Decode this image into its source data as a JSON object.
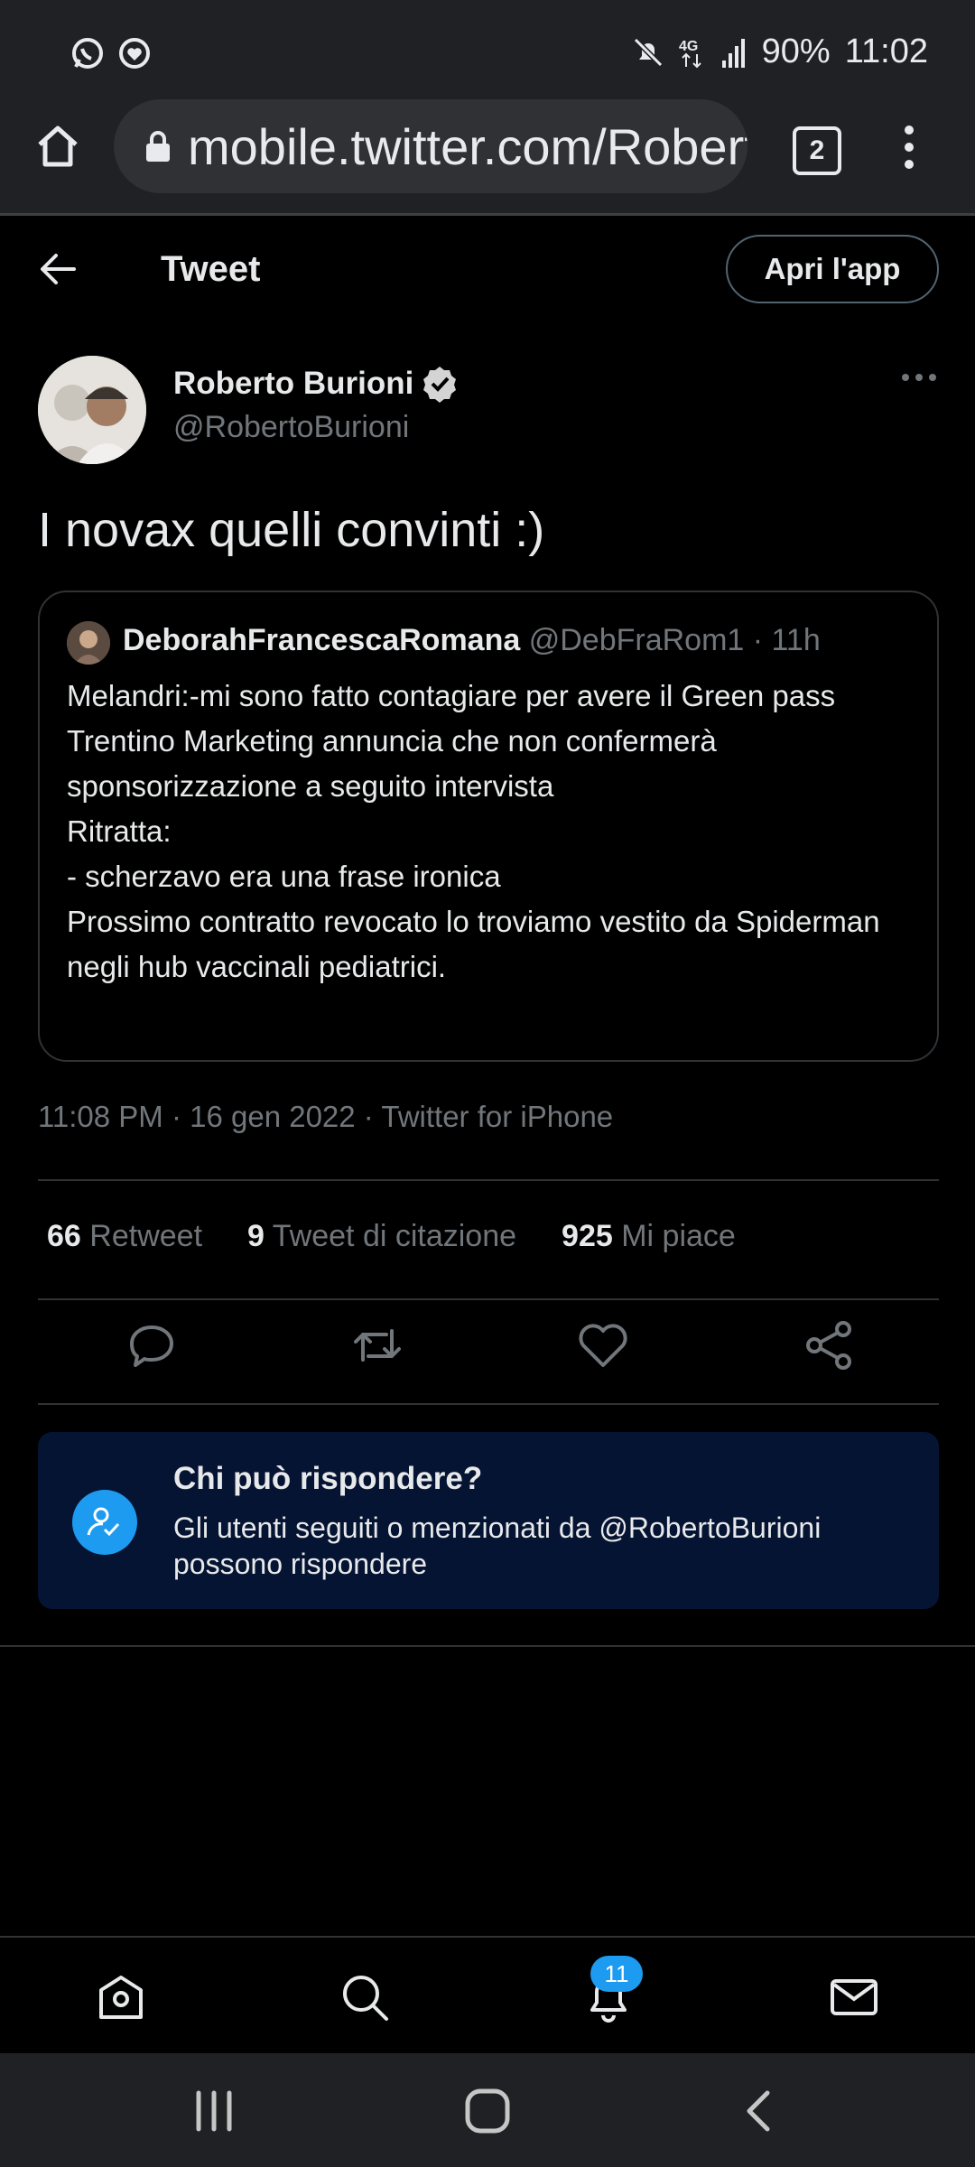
{
  "status_bar": {
    "battery": "90%",
    "time": "11:02",
    "network": "4G",
    "icons_left": [
      "whatsapp-icon",
      "app-notification-icon"
    ],
    "icons_right": [
      "mute-icon",
      "4g-icon",
      "signal-icon"
    ]
  },
  "browser": {
    "url": "mobile.twitter.com/RobertoBurioni",
    "tab_count": "2"
  },
  "header": {
    "title": "Tweet",
    "open_app_label": "Apri l'app"
  },
  "tweet": {
    "author_name": "Roberto Burioni",
    "author_handle": "@RobertoBurioni",
    "text": "I novax quelli convinti :)",
    "timestamp": "11:08 PM · 16 gen 2022 · Twitter for iPhone"
  },
  "quote": {
    "name": "DeborahFrancescaRomana",
    "meta": " @DebFraRom1 · 11h",
    "body": "Melandri:-mi sono fatto contagiare per avere il Green pass\nTrentino Marketing annuncia che non confermerà sponsorizzazione a seguito intervista\nRitratta:\n- scherzavo era una frase ironica\nProssimo contratto revocato lo troviamo vestito da Spiderman negli hub vaccinali pediatrici."
  },
  "stats": {
    "retweets": "66",
    "retweets_label": "Retweet",
    "quotes": "9",
    "quotes_label": "Tweet di citazione",
    "likes": "925",
    "likes_label": "Mi piace"
  },
  "reply_box": {
    "title": "Chi può rispondere?",
    "description": "Gli utenti seguiti o menzionati da @RobertoBurioni possono rispondere"
  },
  "bottom_nav": {
    "notification_count": "11"
  },
  "colors": {
    "background": "#000000",
    "accent": "#1d9bf0",
    "secondary_text": "#71767b",
    "reply_box_bg": "#061433"
  }
}
